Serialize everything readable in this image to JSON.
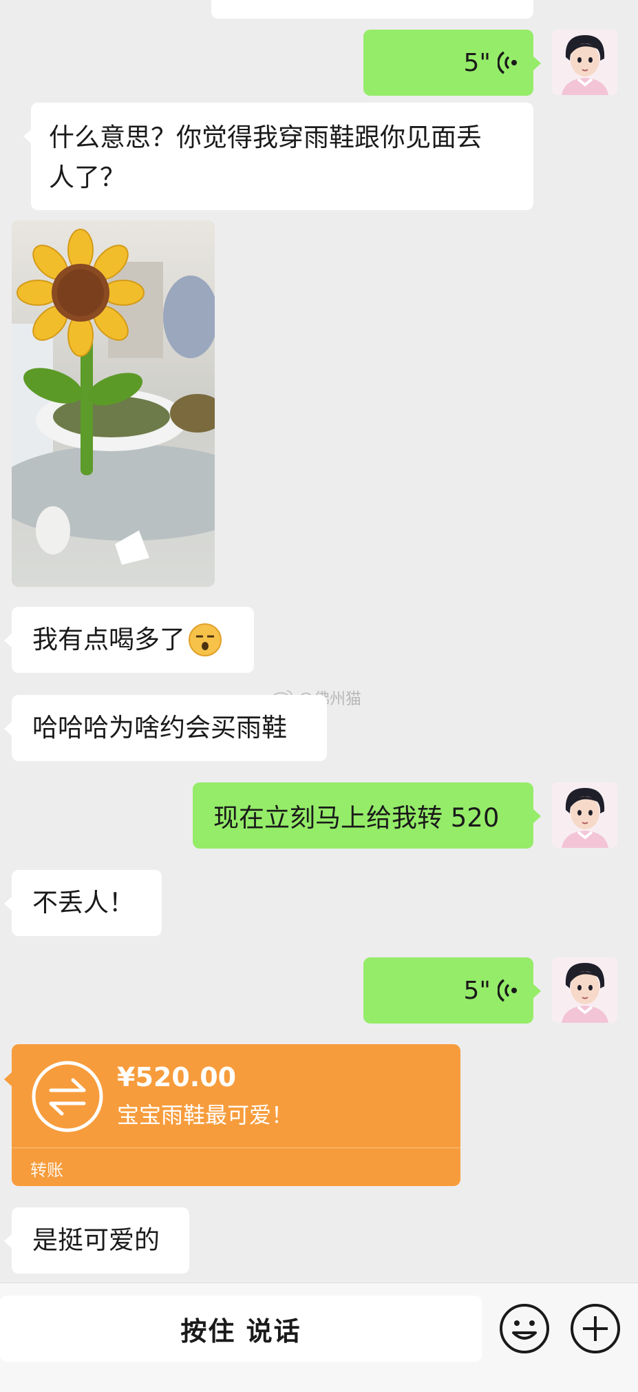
{
  "messages": {
    "voice1": {
      "duration": "5\""
    },
    "msg_meaning": {
      "text_line1": "什么意思？你觉得我穿雨鞋跟你见面丢",
      "text_line2": "人了？"
    },
    "msg_drunk": {
      "text": "我有点喝多了"
    },
    "watermark": {
      "text": "@佛州猫"
    },
    "msg_haha": {
      "text": "哈哈哈为啥约会买雨鞋"
    },
    "msg_transfer_request": {
      "text": "现在立刻马上给我转 520"
    },
    "msg_not_embarrassing": {
      "text": "不丢人！"
    },
    "voice2": {
      "duration": "5\""
    },
    "transfer": {
      "amount": "¥520.00",
      "note": "宝宝雨鞋最可爱！",
      "label": "转账"
    },
    "msg_cute": {
      "text": "是挺可爱的"
    }
  },
  "input_bar": {
    "talk_label": "按住 说话",
    "emoji_icon": "emoji-icon",
    "plus_icon": "plus-icon"
  },
  "colors": {
    "green_bubble": "#95ec69",
    "transfer_orange": "#f79c3c",
    "background": "#ededed"
  }
}
